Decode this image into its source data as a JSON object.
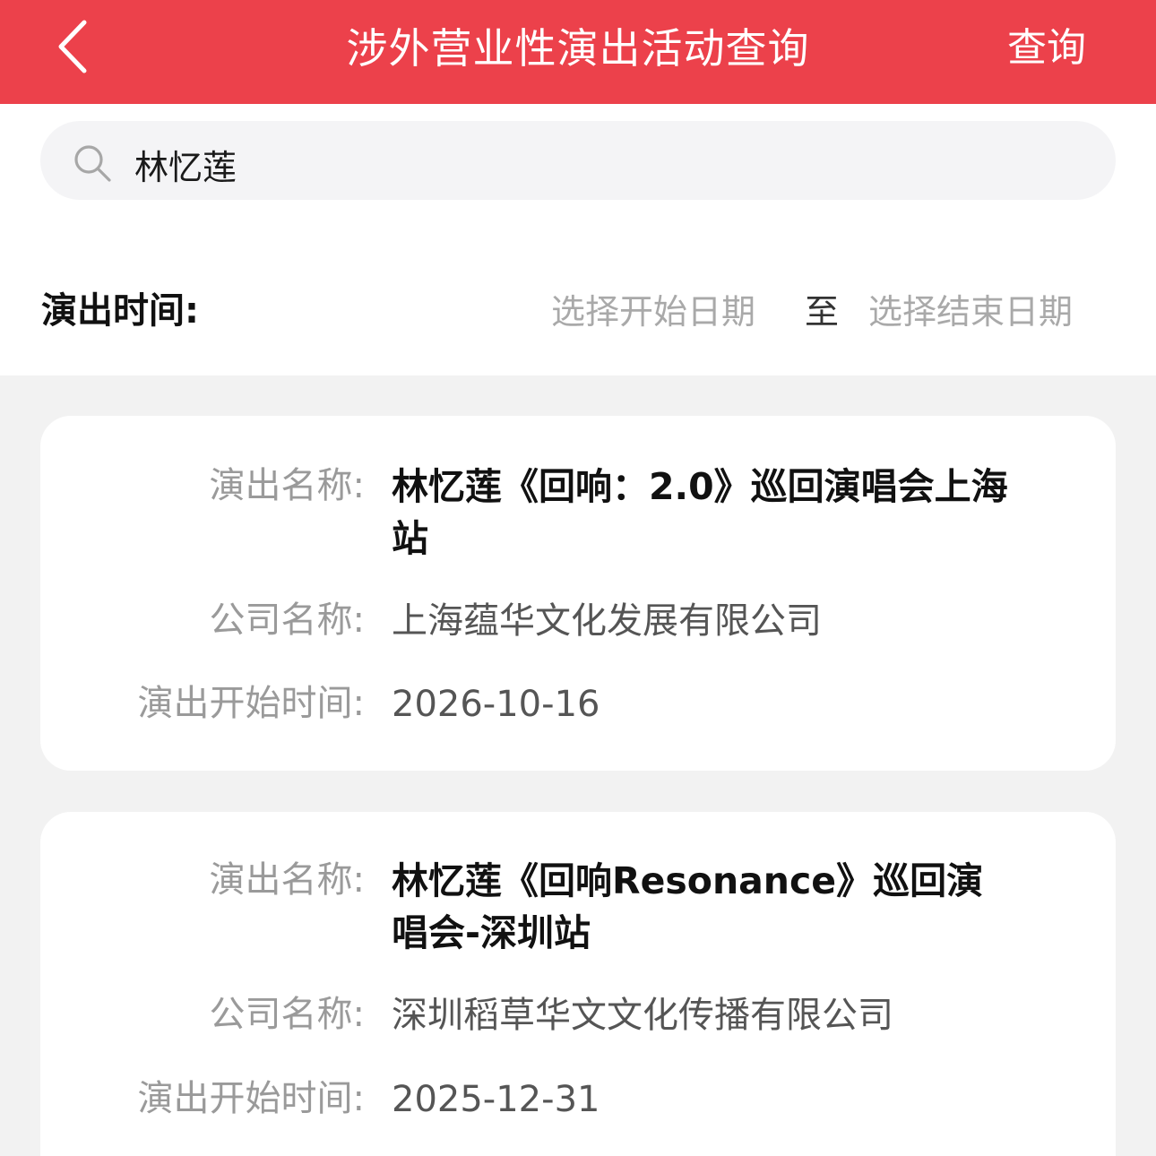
{
  "header": {
    "title": "涉外营业性演出活动查询",
    "query_label": "查询"
  },
  "search": {
    "value": "林忆莲",
    "placeholder": ""
  },
  "filter": {
    "time_label": "演出时间:",
    "start_placeholder": "选择开始日期",
    "separator": "至",
    "end_placeholder": "选择结束日期"
  },
  "labels": {
    "name": "演出名称:",
    "company": "公司名称:",
    "start_time": "演出开始时间:"
  },
  "results": [
    {
      "name": "林忆莲《回响：2.0》巡回演唱会上海站",
      "company": "上海蕴华文化发展有限公司",
      "start_time": "2026-10-16"
    },
    {
      "name": "林忆莲《回响Resonance》巡回演唱会-深圳站",
      "company": "深圳稻草华文文化传播有限公司",
      "start_time": "2025-12-31"
    }
  ],
  "icons": {
    "back": "chevron-left-icon",
    "search": "search-icon"
  },
  "colors": {
    "header_bg": "#ec414b",
    "page_bg": "#f2f2f2"
  }
}
